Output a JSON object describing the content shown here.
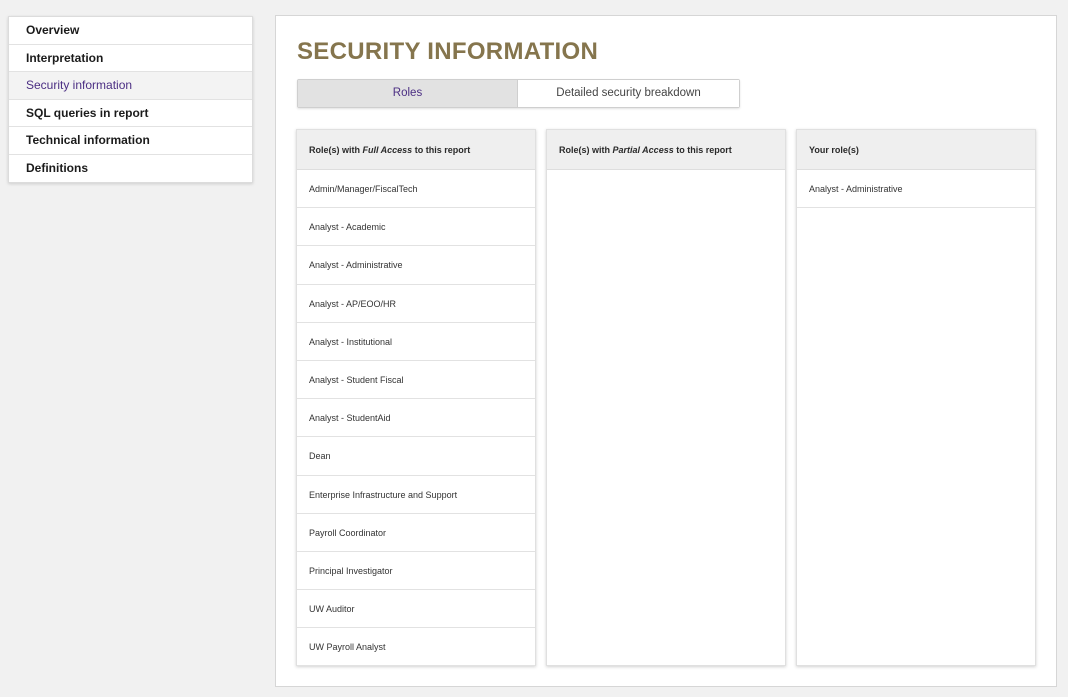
{
  "sidebar": {
    "items": [
      {
        "label": "Overview",
        "active": false
      },
      {
        "label": "Interpretation",
        "active": false
      },
      {
        "label": "Security information",
        "active": true
      },
      {
        "label": "SQL queries in report",
        "active": false
      },
      {
        "label": "Technical information",
        "active": false
      },
      {
        "label": "Definitions",
        "active": false
      }
    ]
  },
  "main": {
    "title": "SECURITY INFORMATION",
    "title_color": "#85754d",
    "accent_color": "#4b2e83",
    "tabs": [
      {
        "label": "Roles",
        "selected": true
      },
      {
        "label": "Detailed security breakdown",
        "selected": false
      }
    ],
    "columns": {
      "full": {
        "header_pre": "Role(s) with ",
        "header_em": "Full Access",
        "header_post": " to this report",
        "roles": [
          "Admin/Manager/FiscalTech",
          "Analyst - Academic",
          "Analyst - Administrative",
          "Analyst - AP/EOO/HR",
          "Analyst - Institutional",
          "Analyst - Student Fiscal",
          "Analyst - StudentAid",
          "Dean",
          "Enterprise Infrastructure and Support",
          "Payroll Coordinator",
          "Principal Investigator",
          "UW Auditor",
          "UW Payroll Analyst"
        ]
      },
      "partial": {
        "header_pre": "Role(s) with ",
        "header_em": "Partial Access",
        "header_post": " to this report",
        "roles": []
      },
      "yours": {
        "header": "Your role(s)",
        "roles": [
          "Analyst - Administrative"
        ]
      }
    }
  }
}
